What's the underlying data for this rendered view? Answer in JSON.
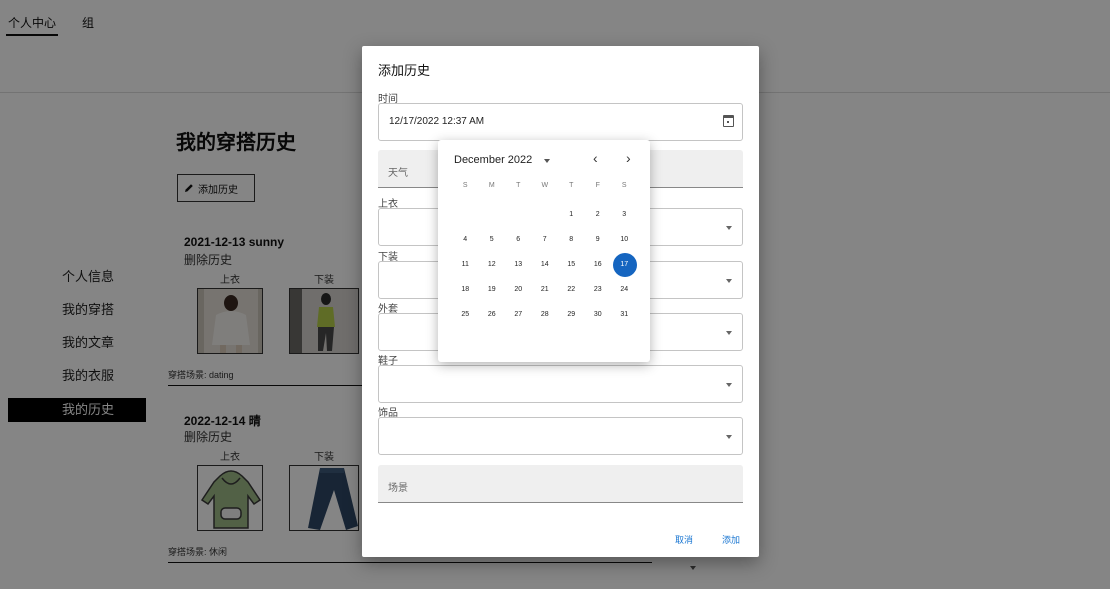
{
  "topnav": {
    "tabs": [
      {
        "label": "个人中心"
      },
      {
        "label": "组"
      }
    ]
  },
  "sidebar": {
    "items": [
      {
        "label": "个人信息"
      },
      {
        "label": "我的穿搭"
      },
      {
        "label": "我的文章"
      },
      {
        "label": "我的衣服"
      },
      {
        "label": "我的历史"
      }
    ]
  },
  "main": {
    "title": "我的穿搭历史",
    "add_label": "添加历史",
    "entries": [
      {
        "date": "2021-12-13 sunny",
        "delete": "删除历史",
        "top": "上衣",
        "bottom": "下装",
        "scene": "穿搭场景: dating"
      },
      {
        "date": "2022-12-14 晴",
        "delete": "删除历史",
        "top": "上衣",
        "bottom": "下装",
        "scene": "穿搭场景: 休闲"
      }
    ]
  },
  "dialog": {
    "title": "添加历史",
    "time_label": "时间",
    "time_value": "12/17/2022 12:37 AM",
    "weather_placeholder": "天气",
    "top_label": "上衣",
    "bottom_label": "下装",
    "coat_label": "外套",
    "shoes_label": "鞋子",
    "accessory_label": "饰品",
    "scene_placeholder": "场景",
    "cancel": "取消",
    "add": "添加"
  },
  "calendar": {
    "month": "December 2022",
    "prev": "‹",
    "next": "›",
    "weekdays": [
      "S",
      "M",
      "T",
      "W",
      "T",
      "F",
      "S"
    ],
    "weeks": [
      [
        "",
        "",
        "",
        "",
        "1",
        "2",
        "3"
      ],
      [
        "4",
        "5",
        "6",
        "7",
        "8",
        "9",
        "10"
      ],
      [
        "11",
        "12",
        "13",
        "14",
        "15",
        "16",
        "17"
      ],
      [
        "18",
        "19",
        "20",
        "21",
        "22",
        "23",
        "24"
      ],
      [
        "25",
        "26",
        "27",
        "28",
        "29",
        "30",
        "31"
      ]
    ],
    "selected": "17",
    "accent": "#1565c0"
  }
}
